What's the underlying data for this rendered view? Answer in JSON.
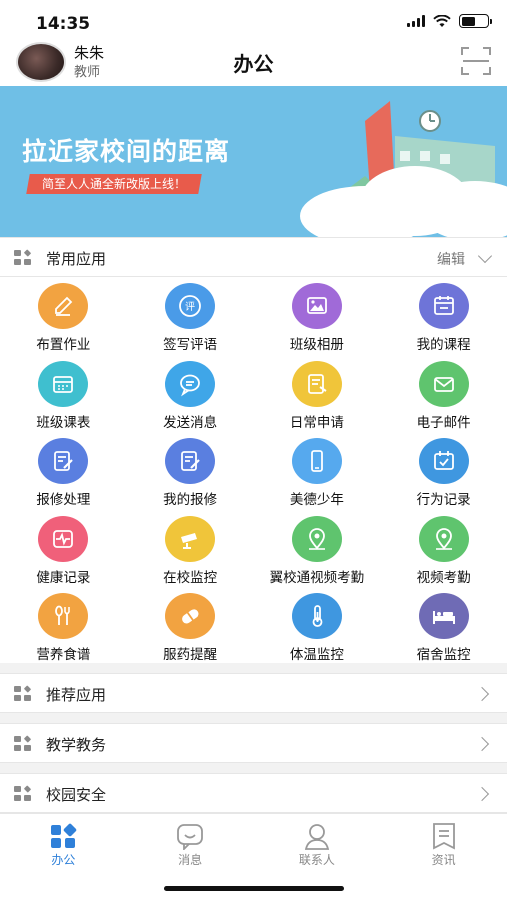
{
  "status_bar": {
    "time": "14:35"
  },
  "header": {
    "user_name": "朱朱",
    "user_role": "教师",
    "title": "办公",
    "scan_icon": "scan-icon"
  },
  "banner": {
    "title": "拉近家校间的距离",
    "tagline": "简至人人通全新改版上线！"
  },
  "common_apps": {
    "title": "常用应用",
    "edit_label": "编辑",
    "items": [
      {
        "label": "布置作业",
        "icon": "pencil-icon",
        "color": "#f2a341"
      },
      {
        "label": "签写评语",
        "icon": "comment-icon",
        "color": "#4a9be8"
      },
      {
        "label": "班级相册",
        "icon": "photo-icon",
        "color": "#a06ad8"
      },
      {
        "label": "我的课程",
        "icon": "course-icon",
        "color": "#6e74d8"
      },
      {
        "label": "班级课表",
        "icon": "calendar-icon",
        "color": "#3fbfcf"
      },
      {
        "label": "发送消息",
        "icon": "message-icon",
        "color": "#3fa6e8"
      },
      {
        "label": "日常申请",
        "icon": "apply-icon",
        "color": "#f0c53a"
      },
      {
        "label": "电子邮件",
        "icon": "mail-icon",
        "color": "#5fc46e"
      },
      {
        "label": "报修处理",
        "icon": "repair-icon",
        "color": "#5a7fe0"
      },
      {
        "label": "我的报修",
        "icon": "my-repair-icon",
        "color": "#5a7fe0"
      },
      {
        "label": "美德少年",
        "icon": "phone-icon",
        "color": "#56a9ee"
      },
      {
        "label": "行为记录",
        "icon": "record-icon",
        "color": "#3f97e0"
      },
      {
        "label": "健康记录",
        "icon": "health-icon",
        "color": "#f0607a"
      },
      {
        "label": "在校监控",
        "icon": "camera-icon",
        "color": "#f0c53a"
      },
      {
        "label": "翼校通视频考勤",
        "icon": "location-icon",
        "color": "#5fc46e"
      },
      {
        "label": "视频考勤",
        "icon": "location-icon",
        "color": "#5fc46e"
      },
      {
        "label": "营养食谱",
        "icon": "fork-spoon-icon",
        "color": "#f2a341"
      },
      {
        "label": "服药提醒",
        "icon": "pill-icon",
        "color": "#f2a341"
      },
      {
        "label": "体温监控",
        "icon": "thermometer-icon",
        "color": "#3f97e0"
      },
      {
        "label": "宿舍监控",
        "icon": "bed-icon",
        "color": "#6f6bb5"
      }
    ]
  },
  "sections": [
    {
      "title": "推荐应用"
    },
    {
      "title": "教学教务"
    },
    {
      "title": "校园安全"
    }
  ],
  "tabbar": {
    "tabs": [
      {
        "label": "办公",
        "icon": "office-icon",
        "active": true
      },
      {
        "label": "消息",
        "icon": "message-icon",
        "active": false
      },
      {
        "label": "联系人",
        "icon": "contacts-icon",
        "active": false
      },
      {
        "label": "资讯",
        "icon": "news-icon",
        "active": false
      }
    ],
    "active_color": "#2f80d9"
  }
}
